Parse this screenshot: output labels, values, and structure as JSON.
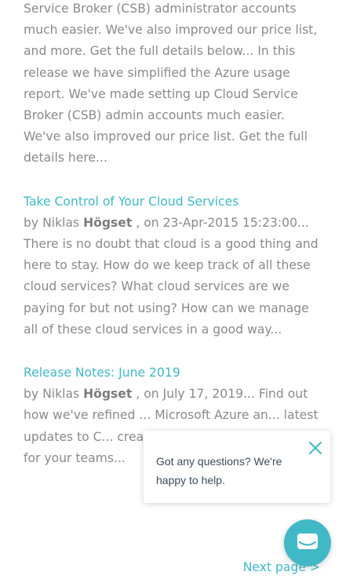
{
  "colors": {
    "link": "#41b8c6",
    "body_text": "#8a8a8a",
    "chat_launcher": "#41b8c6"
  },
  "posts": [
    {
      "excerpt": "Service Broker (CSB) administrator accounts much easier. We've also improved our price list, and more. Get the full details below... In this release we have simplified the Azure usage report. We've made setting up Cloud Service Broker (CSB) admin accounts much easier. We've also improved our price list. Get the full details here..."
    },
    {
      "title": "Take Control of Your Cloud Services",
      "meta_prefix": "by Niklas ",
      "author_last": "Högset",
      "meta_suffix": " , on 23-Apr-2015 15:23:00...",
      "excerpt": "There is no doubt that cloud is a good thing and here to stay. How do we keep track of all these cloud services? What cloud services are we paying for but not using? How can we manage all of these cloud services in a good way..."
    },
    {
      "title": "Release Notes: June 2019",
      "meta_prefix": "by Niklas ",
      "author_last": "Högset",
      "meta_suffix": " , on July 17, 2019...",
      "excerpt": " Find out how we've refined ... Microsoft Azure an... latest updates to C... created a brand-new admin role for your teams..."
    }
  ],
  "pagination": {
    "next_label": "Next page >"
  },
  "chat": {
    "prompt": "Got any questions? We're happy to help.",
    "close_icon": "close-icon",
    "launcher_icon": "chat-icon"
  }
}
